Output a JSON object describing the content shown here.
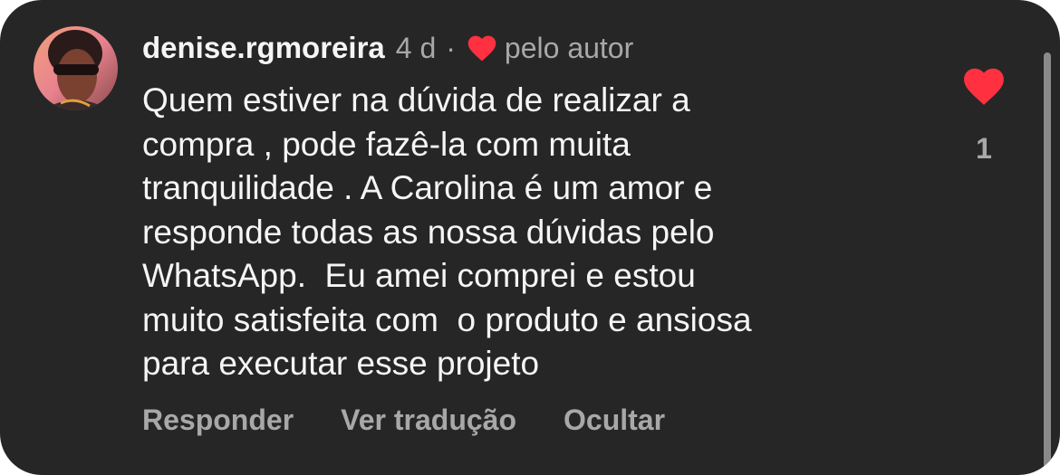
{
  "comment": {
    "username": "denise.rgmoreira",
    "time": "4 d",
    "separator": "·",
    "liked_by_author_label": "pelo autor",
    "text_lines": [
      "Quem estiver na dúvida de realizar a",
      "compra , pode fazê-la com muita",
      "tranquilidade . A Carolina é um amor e",
      "responde todas as nossa dúvidas pelo",
      "WhatsApp.  Eu amei comprei e estou",
      "muito satisfeita com  o produto e ansiosa",
      "para executar esse projeto"
    ],
    "like_count": "1",
    "liked": true
  },
  "actions": {
    "reply": "Responder",
    "translate": "Ver tradução",
    "hide": "Ocultar"
  },
  "icons": {
    "author_heart": "heart-icon",
    "like": "heart-icon",
    "avatar": "avatar-photo"
  },
  "colors": {
    "background": "#262626",
    "heart": "#ff3040",
    "primary_text": "#f5f5f5",
    "secondary_text": "#a8a8a8"
  }
}
